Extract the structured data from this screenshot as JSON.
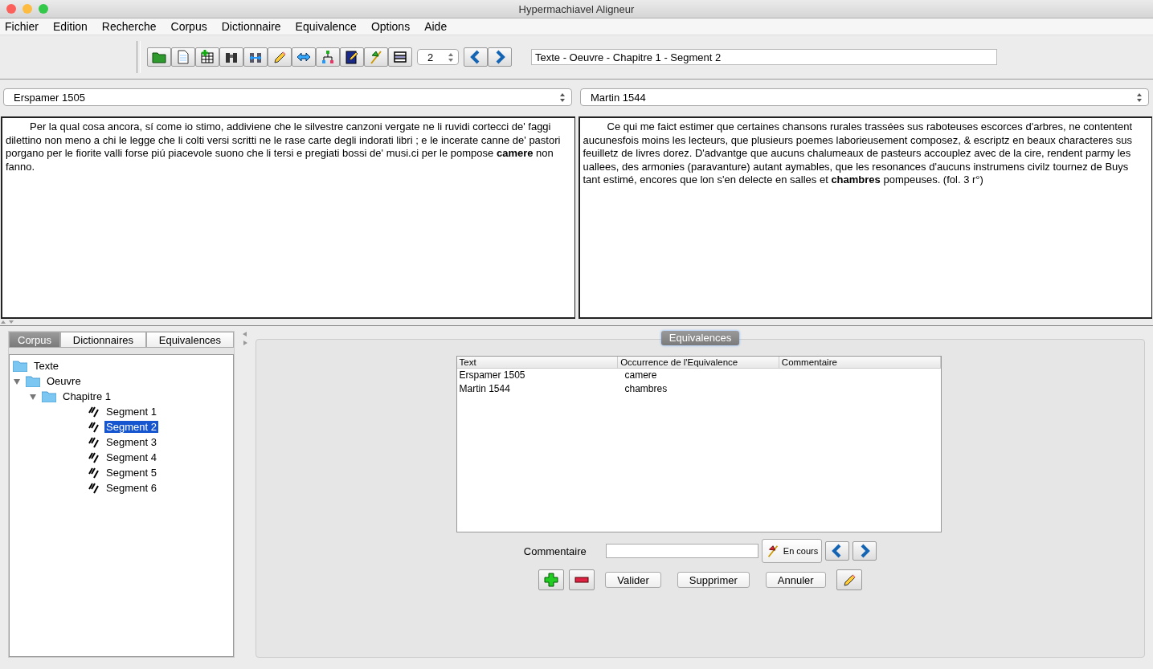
{
  "window": {
    "title": "Hypermachiavel Aligneur"
  },
  "menu": [
    "Fichier",
    "Edition",
    "Recherche",
    "Corpus",
    "Dictionnaire",
    "Equivalence",
    "Options",
    "Aide"
  ],
  "toolbar": {
    "spinner": "2",
    "path": "Texte - Oeuvre - Chapitre 1 - Segment 2"
  },
  "panes": [
    {
      "source": "Erspamer 1505",
      "text": "Per la qual cosa ancora, sí come io stimo, addiviene che le silvestre canzoni vergate ne li ruvidi cortecci de' faggi dilettino non meno a chi le legge che li colti versi scritti ne le rase carte degli indorati libri ; e le incerate canne de' pastori porgano per le fiorite valli forse piú piacevole suono che li tersi e pregiati bossi de' musi.ci per le pompose **camere** non fanno."
    },
    {
      "source": "Martin 1544",
      "text": "Ce qui me faict estimer que certaines chansons rurales trassées sus raboteuses escorces d'arbres, ne contentent aucunesfois moins les lecteurs, que plusieurs poemes laborieusement composez, & escriptz en beaux characteres sus feuilletz de livres dorez. D'advantge que aucuns chalumeaux de pasteurs accouplez avec de la cire, rendent parmy les uallees, des armonies (paravanture) autant aymables, que les resonances d'aucuns instrumens civilz tournez de Buys tant estimé, encores que lon s'en delecte en salles et **chambres** pompeuses. (fol. 3 r°)"
    }
  ],
  "tabs": [
    {
      "label": "Corpus",
      "selected": true
    },
    {
      "label": "Dictionnaires",
      "selected": false
    },
    {
      "label": "Equivalences",
      "selected": false
    }
  ],
  "tree": [
    {
      "label": "Texte",
      "kind": "folder",
      "selected": false
    },
    {
      "label": "Oeuvre",
      "kind": "folder",
      "selected": false,
      "expanded": true,
      "children": [
        {
          "label": "Chapitre 1",
          "kind": "folder",
          "selected": false,
          "expanded": true,
          "children": [
            {
              "label": "Segment 1",
              "kind": "segment",
              "selected": false
            },
            {
              "label": "Segment 2",
              "kind": "segment",
              "selected": true
            },
            {
              "label": "Segment 3",
              "kind": "segment",
              "selected": false
            },
            {
              "label": "Segment 4",
              "kind": "segment",
              "selected": false
            },
            {
              "label": "Segment 5",
              "kind": "segment",
              "selected": false
            },
            {
              "label": "Segment 6",
              "kind": "segment",
              "selected": false
            }
          ]
        }
      ]
    }
  ],
  "equivalences": {
    "title": "Equivalences",
    "columns": [
      "Text",
      "Occurrence de l'Equivalence",
      "Commentaire"
    ],
    "rows": [
      [
        "Erspamer 1505",
        "camere"
      ],
      [
        "Martin 1544",
        "chambres"
      ]
    ],
    "comment_label": "Commentaire",
    "status_button": "En cours",
    "buttons": [
      "Valider",
      "Supprimer",
      "Annuler"
    ]
  }
}
